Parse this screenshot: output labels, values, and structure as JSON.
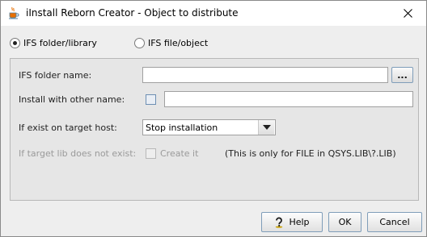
{
  "window": {
    "title": "iInstall Reborn Creator - Object to distribute",
    "app_icon": "java-coffee-cup-icon",
    "close_icon": "close-icon"
  },
  "source_type": {
    "options": [
      {
        "label": "IFS folder/library",
        "selected": true
      },
      {
        "label": "IFS file/object",
        "selected": false
      }
    ]
  },
  "form": {
    "folder_name_label": "IFS folder name:",
    "folder_name_value": "",
    "browse_label": "...",
    "other_name_label": "Install with other name:",
    "other_name_checked": false,
    "other_name_value": "",
    "exist_label": "If exist on target host:",
    "exist_selected": "Stop installation",
    "target_lib_label": "If target lib does not exist:",
    "create_it_label": "Create it",
    "create_it_checked": false,
    "note": "(This is only for FILE in QSYS.LIB\\?.LIB)"
  },
  "buttons": {
    "help": "Help",
    "ok": "OK",
    "cancel": "Cancel"
  },
  "colors": {
    "window_bg": "#eeeeee",
    "panel_bg": "#e6e6e6",
    "button_border": "#7f9db9",
    "disabled_text": "#9a9a9a"
  }
}
